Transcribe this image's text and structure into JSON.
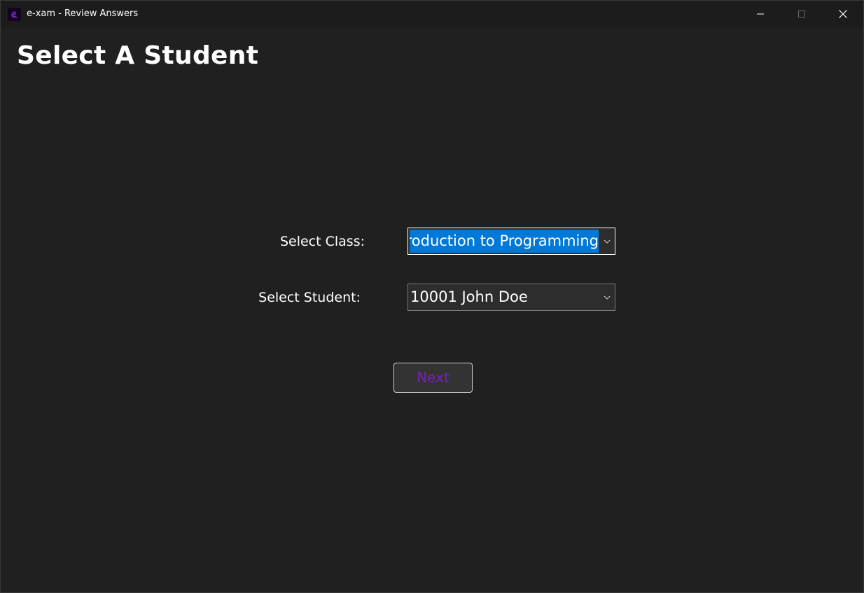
{
  "window": {
    "title": "e-xam - Review Answers",
    "app_icon": "e-xam-logo-icon",
    "controls": [
      "minimize-icon",
      "maximize-icon",
      "close-icon"
    ]
  },
  "page": {
    "title": "Select A Student"
  },
  "form": {
    "class_label": "Select Class:",
    "class_value": "roduction to Programming",
    "student_label": "Select Student:",
    "student_value": "10001 John Doe",
    "next_label": "Next"
  },
  "colors": {
    "background": "#202020",
    "selection": "#0078d7",
    "accent_text": "#7a1fb8"
  }
}
